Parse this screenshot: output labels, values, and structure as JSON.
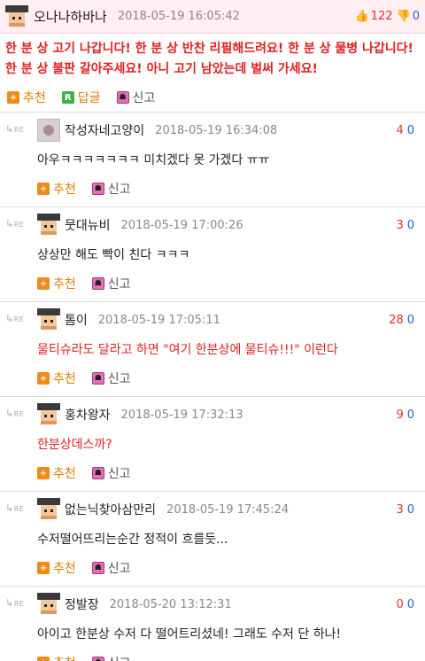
{
  "post": {
    "nickname": "오나나하바나",
    "date": "2018-05-19 16:05:42",
    "up_votes": "122",
    "down_votes": "0",
    "body": "한 분 상 고기 나갑니다! 한 분 상 반찬 리필해드려요! 한 분 상 물병 나갑니다! 한 분 상 불판 갈아주세요! 아니 고기 남았는데 벌써 가세요!",
    "actions": {
      "recommend": "추천",
      "reply": "답글",
      "report": "신고"
    }
  },
  "reply_icon": {
    "re": "RE"
  },
  "comment_actions": {
    "recommend": "추천",
    "report": "신고"
  },
  "comments": [
    {
      "avatar": "photo",
      "nickname": "작성자네고양이",
      "date": "2018-05-19 16:34:08",
      "up": "4",
      "down": "0",
      "text": "아우ㅋㅋㅋㅋㅋㅋㅋ 미치겠다 못 가겠다 ㅠㅠ",
      "red": false
    },
    {
      "avatar": "cap",
      "nickname": "뭇대뉴비",
      "date": "2018-05-19 17:00:26",
      "up": "3",
      "down": "0",
      "text": "상상만 해도 빡이 친다 ㅋㅋㅋ",
      "red": false
    },
    {
      "avatar": "cap",
      "nickname": "톰이",
      "date": "2018-05-19 17:05:11",
      "up": "28",
      "down": "0",
      "text": "물티슈라도 달라고 하면 \"여기 한분상에 물티슈!!!\" 이런다",
      "red": true
    },
    {
      "avatar": "cap",
      "nickname": "홍차왕자",
      "date": "2018-05-19 17:32:13",
      "up": "9",
      "down": "0",
      "text": "한분상데스까?",
      "red": true
    },
    {
      "avatar": "cap",
      "nickname": "없는닉찾아삼만리",
      "date": "2018-05-19 17:45:24",
      "up": "3",
      "down": "0",
      "text": "수저떨어뜨리는순간 정적이 흐를듯...",
      "red": false
    },
    {
      "avatar": "cap",
      "nickname": "정발장",
      "date": "2018-05-20 13:12:31",
      "up": "0",
      "down": "0",
      "text": "아이고 한분상 수저 다 떨어트리셨네! 그래도 수저 단 하나!",
      "red": false
    }
  ]
}
